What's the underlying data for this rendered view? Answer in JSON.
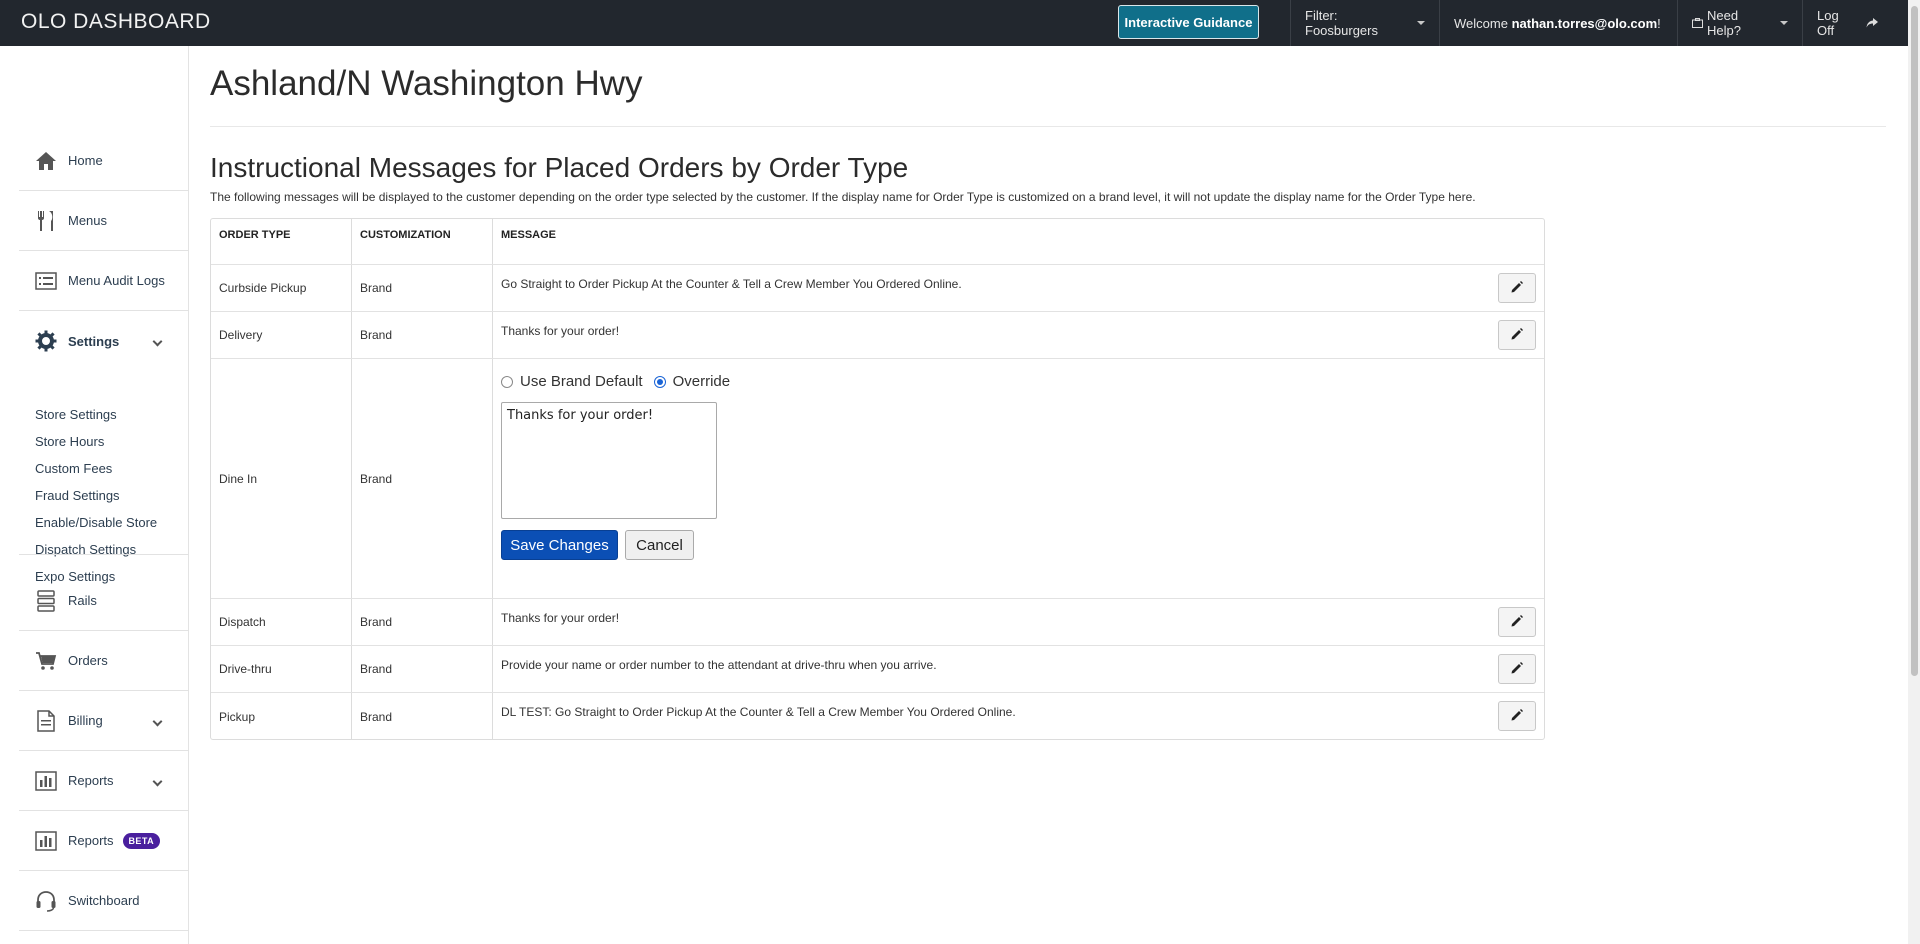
{
  "topbar": {
    "brand": "OLO DASHBOARD",
    "guidance_button": "Interactive Guidance",
    "filter_label": "Filter: Foosburgers",
    "welcome_prefix": "Welcome ",
    "welcome_user": "nathan.torres@olo.com",
    "welcome_suffix": "!",
    "help_label": "Need Help?",
    "logoff_label": "Log Off"
  },
  "sidebar": {
    "home": "Home",
    "menus": "Menus",
    "menu_audit_logs": "Menu Audit Logs",
    "settings": "Settings",
    "settings_sub": [
      "Store Settings",
      "Store Hours",
      "Custom Fees",
      "Fraud Settings",
      "Enable/Disable Store",
      "Dispatch Settings",
      "Expo Settings"
    ],
    "rails": "Rails",
    "orders": "Orders",
    "billing": "Billing",
    "reports": "Reports",
    "reports_beta": "Reports",
    "beta_badge": "BETA",
    "switchboard": "Switchboard"
  },
  "page": {
    "title": "Ashland/N Washington Hwy",
    "section_title": "Instructional Messages for Placed Orders by Order Type",
    "section_desc": "The following messages will be displayed to the customer depending on the order type selected by the customer. If the display name for Order Type is customized on a brand level, it will not update the display name for the Order Type here."
  },
  "table": {
    "headers": [
      "ORDER TYPE",
      "CUSTOMIZATION",
      "MESSAGE"
    ],
    "rows": [
      {
        "type": "Curbside Pickup",
        "customization": "Brand",
        "message": "Go Straight to Order Pickup At the Counter & Tell a Crew Member You Ordered Online."
      },
      {
        "type": "Delivery",
        "customization": "Brand",
        "message": "Thanks for your order!"
      },
      {
        "type": "Dine In",
        "customization": "Brand",
        "message": "Thanks for your order!"
      },
      {
        "type": "Dispatch",
        "customization": "Brand",
        "message": "Thanks for your order!"
      },
      {
        "type": "Drive-thru",
        "customization": "Brand",
        "message": "Provide your name or order number to the attendant at drive-thru when you arrive."
      },
      {
        "type": "Pickup",
        "customization": "Brand",
        "message": "DL TEST: Go Straight to Order Pickup At the Counter & Tell a Crew Member You Ordered Online."
      }
    ],
    "editor": {
      "option_default": "Use Brand Default",
      "option_override": "Override",
      "selected": "Override",
      "save_label": "Save Changes",
      "cancel_label": "Cancel"
    }
  },
  "colors": {
    "topbar": "#22272e",
    "guidance": "#106f8a",
    "primary": "#0b4fb5",
    "beta": "#4a1f9e"
  }
}
